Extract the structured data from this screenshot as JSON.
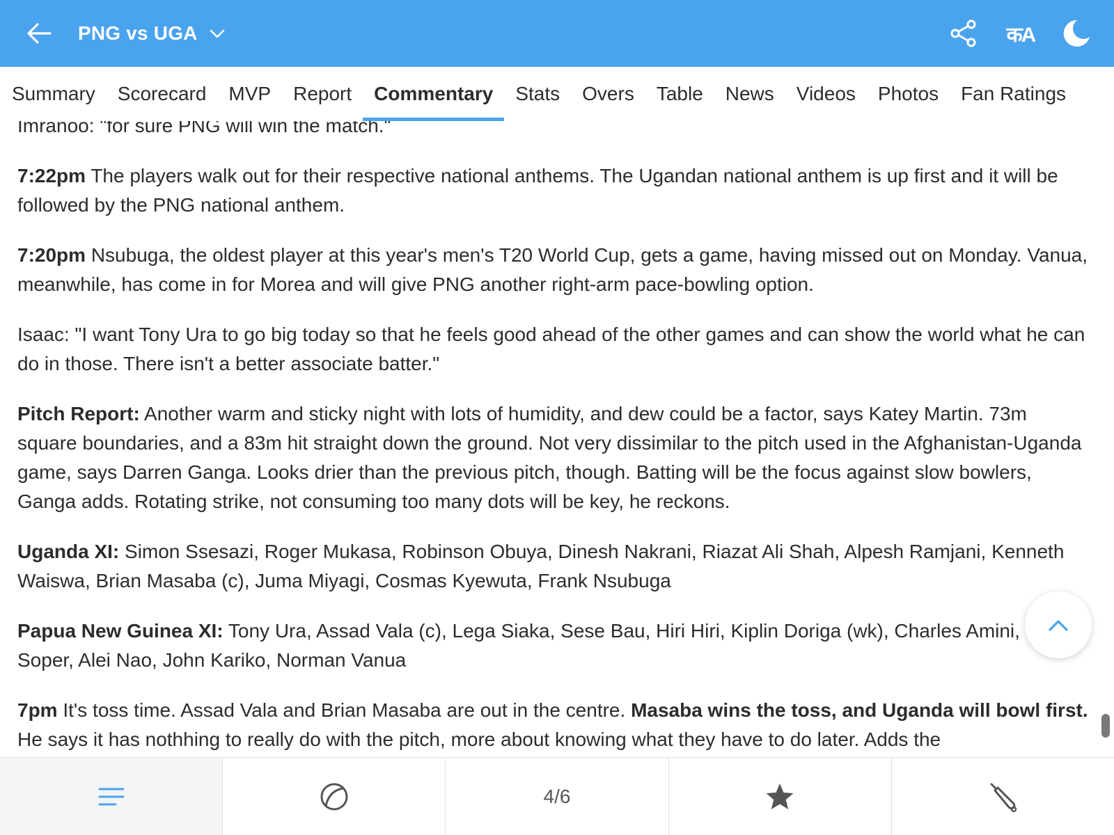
{
  "header": {
    "title": "PNG vs UGA",
    "lang_label": "कA"
  },
  "tabs": [
    {
      "label": "Summary"
    },
    {
      "label": "Scorecard"
    },
    {
      "label": "MVP"
    },
    {
      "label": "Report"
    },
    {
      "label": "Commentary",
      "active": true
    },
    {
      "label": "Stats"
    },
    {
      "label": "Overs"
    },
    {
      "label": "Table"
    },
    {
      "label": "News"
    },
    {
      "label": "Videos"
    },
    {
      "label": "Photos"
    },
    {
      "label": "Fan Ratings"
    }
  ],
  "commentary": [
    {
      "lead": "",
      "text": "Imranoo: \"for sure PNG will win the match.\"",
      "highlight": "",
      "tail": ""
    },
    {
      "lead": "7:22pm",
      "text": " The players walk out for their respective national anthems. The Ugandan national anthem is up first and it will be followed by the PNG national anthem.",
      "highlight": "",
      "tail": ""
    },
    {
      "lead": "7:20pm",
      "text": " Nsubuga, the oldest player at this year's men's T20 World Cup, gets a game, having missed out on Monday. Vanua, meanwhile, has come in for Morea and will give PNG another right-arm pace-bowling option.",
      "highlight": "",
      "tail": ""
    },
    {
      "lead": "",
      "text": "Isaac: \"I want Tony Ura to go big today so that he feels good ahead of the other games and can show the world what he can do in those. There isn't a better associate batter.\"",
      "highlight": "",
      "tail": ""
    },
    {
      "lead": "Pitch Report:",
      "text": " Another warm and sticky night with lots of humidity, and dew could be a factor, says Katey Martin. 73m square boundaries, and a 83m hit straight down the ground. Not very dissimilar to the pitch used in the Afghanistan-Uganda game, says Darren Ganga. Looks drier than the previous pitch, though. Batting will be the focus against slow bowlers, Ganga adds. Rotating strike, not consuming too many dots will be key, he reckons.",
      "highlight": "",
      "tail": ""
    },
    {
      "lead": "Uganda XI:",
      "text": " Simon Ssesazi, Roger Mukasa, Robinson Obuya, Dinesh Nakrani, Riazat Ali Shah, Alpesh Ramjani, Kenneth Waiswa, Brian Masaba (c), Juma Miyagi, Cosmas Kyewuta, Frank Nsubuga",
      "highlight": "",
      "tail": ""
    },
    {
      "lead": "Papua New Guinea XI:",
      "text": " Tony Ura, Assad Vala (c), Lega Siaka, Sese Bau, Hiri Hiri, Kiplin Doriga (wk), Charles Amini, Chad Soper, Alei Nao, John Kariko, Norman Vanua",
      "highlight": "",
      "tail": ""
    },
    {
      "lead": "7pm",
      "text": " It's toss time. Assad Vala and Brian Masaba are out in the centre. ",
      "highlight": "Masaba wins the toss, and Uganda will bowl first.",
      "tail": " He says it has nothhing to really do with the pitch, more about knowing what they have to do later. Adds the"
    }
  ],
  "bottom_nav": {
    "page_indicator": "4/6"
  },
  "colors": {
    "accent": "#4aa3ed",
    "text": "#2b2c2d",
    "star": "#555555"
  },
  "icons": [
    "back-arrow-icon",
    "chevron-down-icon",
    "share-icon",
    "language-icon",
    "moon-icon",
    "chevron-up-icon",
    "menu-lines-icon",
    "ball-icon",
    "star-icon",
    "bat-icon"
  ]
}
